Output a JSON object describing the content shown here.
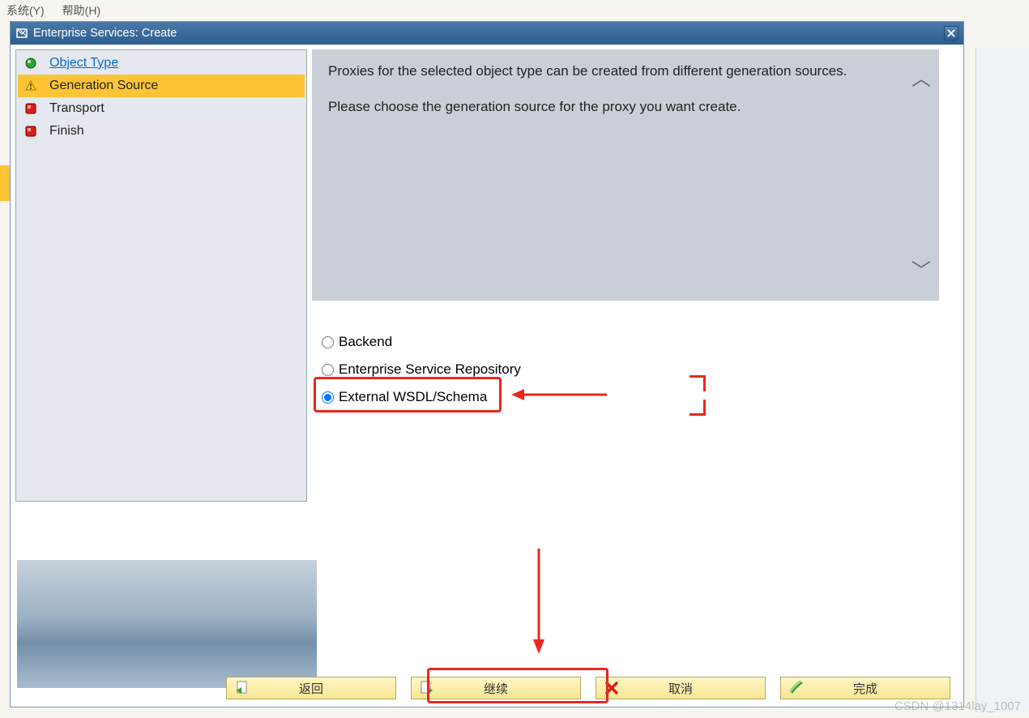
{
  "background_menu": {
    "system": "系统(Y)",
    "help": "帮助(H)"
  },
  "dialog": {
    "title": "Enterprise Services: Create"
  },
  "steps": [
    {
      "label": "Object Type",
      "status": "done-green",
      "link": true
    },
    {
      "label": "Generation Source",
      "status": "current-yellow",
      "link": false
    },
    {
      "label": "Transport",
      "status": "pending-red",
      "link": false
    },
    {
      "label": "Finish",
      "status": "pending-red",
      "link": false
    }
  ],
  "description": {
    "line1": "Proxies for the selected object type can be created from different generation sources.",
    "line2": "Please choose the generation source for the proxy you want create."
  },
  "radios": [
    {
      "label": "Backend",
      "selected": false
    },
    {
      "label": "Enterprise Service Repository",
      "selected": false
    },
    {
      "label": "External WSDL/Schema",
      "selected": true
    }
  ],
  "buttons": {
    "back": "返回",
    "continue": "继续",
    "cancel": "取消",
    "finish": "完成"
  },
  "watermark": "CSDN @1314lay_1007"
}
